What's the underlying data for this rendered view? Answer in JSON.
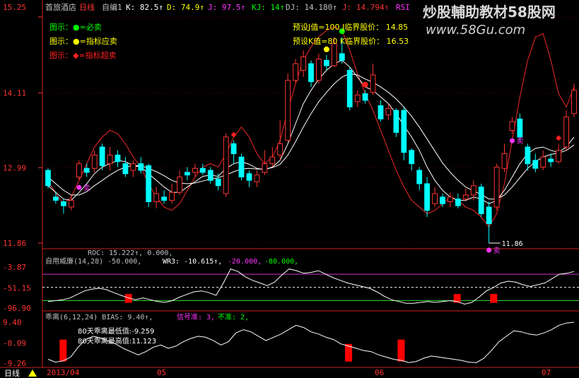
{
  "header": {
    "stock_name": "首旅酒店",
    "period": "日线",
    "indicator_name": "自编1",
    "k": "K: 82.5↑",
    "d": "D: 74.9↑",
    "j": "J: 97.5↑",
    "kj": "KJ: 14↑",
    "dj": "DJ: 14.180↑",
    "jj": "J: 14.794↑",
    "rsi": "RSI"
  },
  "watermark": {
    "line1": "炒股輔助教材58股网",
    "line2": "www.58Gu.com"
  },
  "legend": [
    {
      "text": "图示：●=必卖",
      "color": "#00ff00"
    },
    {
      "text": "图示：●=指标应卖",
      "color": "#ffff00"
    },
    {
      "text": "图示：◆=指标超卖",
      "color": "#ff2020"
    }
  ],
  "preset": {
    "l1": "预设J值=100 J临界股价： 14.85",
    "l2": "预设K值=80 K临界股价： 16.53"
  },
  "colors": {
    "up": "#ff3333",
    "down": "#00ffff",
    "ma1": "#ffffff",
    "line_red": "#cc2222",
    "bg": "#000000",
    "axis": "#ff3333"
  },
  "chart_data": [
    {
      "type": "candlestick",
      "title": "首旅酒店",
      "ylim": [
        11.86,
        15.25
      ],
      "y_ticks": [
        "15.25",
        "14.11",
        "12.99",
        "11.86"
      ],
      "low_annotation": "11.86",
      "marker_labels": [
        "卖",
        "卖",
        "卖"
      ],
      "candles": [
        [
          12.95,
          12.72,
          12.98,
          12.68
        ],
        [
          12.55,
          12.5,
          12.62,
          12.45
        ],
        [
          12.48,
          12.42,
          12.52,
          12.3
        ],
        [
          12.4,
          12.5,
          12.58,
          12.35
        ],
        [
          12.85,
          13.05,
          13.1,
          12.8
        ],
        [
          12.98,
          12.92,
          13.05,
          12.85
        ],
        [
          12.98,
          13.18,
          13.25,
          12.92
        ],
        [
          13.3,
          13.02,
          13.35,
          12.95
        ],
        [
          13.05,
          13.18,
          13.3,
          12.95
        ],
        [
          13.18,
          13.08,
          13.25,
          13.0
        ],
        [
          13.05,
          12.9,
          13.15,
          12.85
        ],
        [
          12.95,
          13.05,
          13.1,
          12.85
        ],
        [
          13.05,
          12.95,
          13.15,
          12.9
        ],
        [
          13.02,
          12.48,
          13.05,
          12.4
        ],
        [
          12.48,
          12.6,
          12.7,
          12.38
        ],
        [
          12.55,
          12.5,
          12.65,
          12.45
        ],
        [
          12.5,
          12.62,
          12.75,
          12.45
        ],
        [
          12.62,
          12.85,
          12.95,
          12.58
        ],
        [
          12.92,
          12.88,
          13.0,
          12.8
        ],
        [
          12.92,
          12.98,
          13.05,
          12.85
        ],
        [
          12.98,
          12.92,
          13.05,
          12.88
        ],
        [
          12.95,
          12.8,
          13.0,
          12.75
        ],
        [
          12.82,
          12.72,
          12.9,
          12.65
        ],
        [
          12.6,
          13.45,
          13.5,
          12.55
        ],
        [
          13.35,
          13.2,
          13.4,
          13.05
        ],
        [
          13.15,
          12.85,
          13.2,
          12.8
        ],
        [
          12.9,
          12.8,
          12.95,
          12.7
        ],
        [
          12.78,
          12.88,
          12.95,
          12.7
        ],
        [
          12.92,
          13.05,
          13.25,
          12.88
        ],
        [
          13.05,
          13.15,
          13.3,
          13.0
        ],
        [
          13.18,
          13.35,
          13.7,
          13.1
        ],
        [
          13.4,
          14.3,
          14.4,
          13.38
        ],
        [
          14.3,
          14.55,
          14.62,
          14.25
        ],
        [
          14.45,
          14.65,
          14.75,
          14.35
        ],
        [
          14.55,
          14.28,
          14.6,
          14.2
        ],
        [
          14.3,
          14.62,
          14.7,
          14.25
        ],
        [
          14.6,
          14.52,
          14.68,
          14.45
        ],
        [
          14.52,
          14.85,
          14.95,
          14.5
        ],
        [
          14.7,
          14.6,
          14.95,
          14.55
        ],
        [
          14.45,
          13.9,
          14.5,
          13.85
        ],
        [
          13.98,
          14.08,
          14.15,
          13.9
        ],
        [
          14.1,
          14.0,
          14.15,
          13.95
        ],
        [
          14.12,
          14.38,
          14.55,
          14.08
        ],
        [
          13.92,
          13.72,
          14.0,
          13.68
        ],
        [
          13.78,
          13.88,
          13.95,
          13.7
        ],
        [
          13.85,
          13.52,
          13.88,
          13.45
        ],
        [
          13.85,
          13.22,
          13.9,
          13.1
        ],
        [
          13.25,
          13.05,
          13.28,
          12.95
        ],
        [
          12.95,
          12.75,
          13.0,
          12.65
        ],
        [
          12.75,
          12.35,
          12.85,
          12.25
        ],
        [
          12.45,
          12.6,
          12.7,
          12.4
        ],
        [
          12.55,
          12.45,
          12.6,
          12.4
        ],
        [
          12.48,
          12.55,
          12.62,
          12.4
        ],
        [
          12.52,
          12.42,
          12.6,
          12.38
        ],
        [
          12.52,
          12.58,
          12.68,
          12.48
        ],
        [
          12.58,
          12.72,
          12.8,
          12.5
        ],
        [
          12.7,
          12.3,
          12.75,
          12.25
        ],
        [
          12.4,
          12.15,
          12.48,
          11.86
        ],
        [
          12.4,
          13.0,
          13.05,
          12.35
        ],
        [
          12.98,
          13.2,
          13.35,
          12.92
        ],
        [
          13.55,
          13.68,
          13.75,
          13.5
        ],
        [
          13.72,
          13.45,
          13.8,
          13.4
        ],
        [
          13.3,
          13.05,
          13.35,
          12.95
        ],
        [
          13.1,
          12.98,
          13.2,
          12.92
        ],
        [
          13.0,
          13.15,
          13.25,
          12.95
        ],
        [
          13.12,
          13.08,
          13.2,
          13.0
        ],
        [
          13.08,
          13.25,
          13.35,
          13.05
        ],
        [
          13.3,
          13.75,
          13.85,
          13.25
        ],
        [
          13.8,
          14.15,
          14.25,
          13.75
        ]
      ],
      "ma_short": [
        12.72,
        12.62,
        12.52,
        12.5,
        12.62,
        12.75,
        12.9,
        13.0,
        13.05,
        13.1,
        13.08,
        13.02,
        13.0,
        12.9,
        12.8,
        12.7,
        12.62,
        12.62,
        12.7,
        12.78,
        12.86,
        12.88,
        12.86,
        12.98,
        13.05,
        13.08,
        13.04,
        12.98,
        12.96,
        13.0,
        13.1,
        13.35,
        13.65,
        13.95,
        14.15,
        14.32,
        14.45,
        14.55,
        14.6,
        14.5,
        14.35,
        14.2,
        14.15,
        14.05,
        13.95,
        13.8,
        13.62,
        13.45,
        13.25,
        13.0,
        12.8,
        12.65,
        12.55,
        12.5,
        12.5,
        12.55,
        12.52,
        12.45,
        12.5,
        12.65,
        12.85,
        13.05,
        13.2,
        13.28,
        13.3,
        13.25,
        13.22,
        13.3,
        13.45
      ],
      "ma_long": [
        12.85,
        12.75,
        12.65,
        12.58,
        12.58,
        12.63,
        12.72,
        12.8,
        12.88,
        12.95,
        13.0,
        13.02,
        13.02,
        12.98,
        12.93,
        12.87,
        12.8,
        12.76,
        12.75,
        12.76,
        12.79,
        12.82,
        12.84,
        12.88,
        12.93,
        12.97,
        12.98,
        12.97,
        12.97,
        12.99,
        13.04,
        13.18,
        13.38,
        13.6,
        13.8,
        13.98,
        14.12,
        14.25,
        14.35,
        14.4,
        14.38,
        14.32,
        14.27,
        14.2,
        14.12,
        14.02,
        13.9,
        13.76,
        13.6,
        13.42,
        13.24,
        13.06,
        12.92,
        12.8,
        12.7,
        12.64,
        12.59,
        12.52,
        12.52,
        12.58,
        12.7,
        12.84,
        12.98,
        13.08,
        13.15,
        13.19,
        13.21,
        13.25,
        13.33
      ],
      "red_line": [
        12.8,
        12.6,
        12.45,
        12.55,
        12.8,
        13.05,
        13.3,
        13.45,
        13.55,
        13.5,
        13.35,
        13.15,
        13.0,
        12.75,
        12.55,
        12.4,
        12.35,
        12.45,
        12.65,
        12.85,
        13.0,
        13.05,
        13.0,
        13.2,
        13.45,
        13.6,
        13.45,
        13.2,
        13.05,
        13.15,
        13.4,
        13.85,
        14.25,
        14.6,
        14.8,
        14.95,
        15.05,
        15.1,
        15.05,
        14.75,
        14.4,
        14.1,
        13.85,
        13.55,
        13.25,
        12.95,
        12.7,
        12.5,
        12.4,
        12.3,
        12.35,
        12.45,
        12.55,
        12.5,
        12.4,
        12.35,
        12.25,
        12.1,
        12.3,
        12.75,
        13.4,
        14.05,
        14.6,
        14.95,
        15.0,
        14.6,
        14.1,
        13.9,
        14.2
      ]
    },
    {
      "type": "line",
      "title": "自用威廉(14,28)",
      "roc_text": "ROC: 15.222↑, 0.000,",
      "labels": [
        "自用威廉(14,28) -50.000,",
        "WR3: -10.615↑,",
        "-20.000,",
        "-80.000,"
      ],
      "ylim": [
        -96.9,
        -3.87
      ],
      "y_ticks": [
        "-3.87",
        "-51.15",
        "-96.90"
      ],
      "levels": [
        -20,
        -50,
        -80
      ],
      "values": [
        -82,
        -80,
        -78,
        -74,
        -66,
        -58,
        -54,
        -52,
        -55,
        -62,
        -68,
        -74,
        -78,
        -74,
        -78,
        -82,
        -84,
        -80,
        -72,
        -66,
        -60,
        -58,
        -62,
        -68,
        -40,
        -8,
        -14,
        -26,
        -34,
        -40,
        -46,
        -38,
        -22,
        -8,
        -12,
        -18,
        -16,
        -12,
        -20,
        -28,
        -34,
        -40,
        -44,
        -48,
        -52,
        -60,
        -70,
        -78,
        -82,
        -86,
        -86,
        -84,
        -82,
        -84,
        -82,
        -80,
        -82,
        -88,
        -84,
        -72,
        -58,
        -50,
        -40,
        -36,
        -38,
        -44,
        -48,
        -44,
        -40,
        -30,
        -20,
        -18,
        -14
      ],
      "bar_indices": [
        11,
        56,
        61
      ]
    },
    {
      "type": "line",
      "title": "乖离(6,12,24)",
      "labels": [
        "乖离(6,12,24) BIAS: 9.40↑,",
        "信号准: 3,",
        "不准: 2,"
      ],
      "notes": [
        "80天乖离最低值:-9.259",
        "80天乖离最高值:11.123"
      ],
      "ylim": [
        -9.26,
        9.4
      ],
      "y_ticks": [
        "9.40",
        "-0.09",
        "-9.26"
      ],
      "values": [
        -7.5,
        -8.8,
        -8.2,
        -6.5,
        -2.0,
        1.5,
        3.0,
        2.2,
        0.8,
        -0.5,
        -2.5,
        -4.0,
        -5.5,
        -4.0,
        -2.0,
        -1.0,
        -2.5,
        -1.5,
        0.5,
        2.0,
        3.0,
        2.5,
        1.0,
        -1.0,
        0.5,
        4.5,
        6.0,
        5.0,
        3.0,
        1.0,
        2.5,
        4.0,
        6.0,
        8.0,
        7.0,
        5.0,
        4.0,
        2.5,
        1.5,
        -0.5,
        -1.5,
        -2.5,
        -3.5,
        -4.0,
        -5.5,
        -6.5,
        -7.5,
        -8.0,
        -9.0,
        -8.5,
        -7.0,
        -6.0,
        -6.5,
        -7.0,
        -7.5,
        -8.0,
        -8.8,
        -9.0,
        -7.0,
        -3.5,
        0.5,
        3.0,
        5.5,
        5.0,
        4.0,
        3.5,
        4.5,
        6.0,
        8.0,
        9.0,
        9.4
      ],
      "bar_indices": [
        2,
        40,
        47
      ]
    }
  ],
  "footer": {
    "period": "日线",
    "dates": [
      "2013/04",
      "05",
      "06",
      "07"
    ]
  }
}
